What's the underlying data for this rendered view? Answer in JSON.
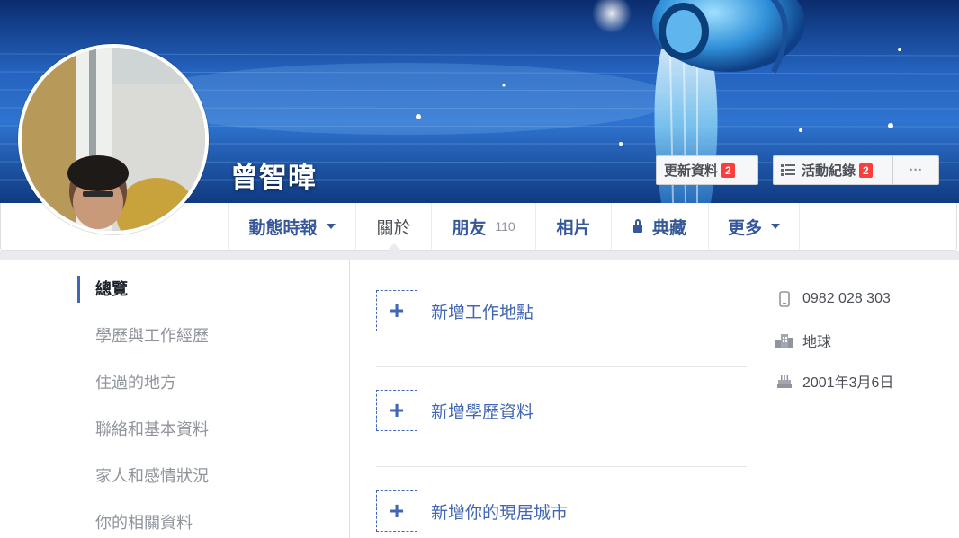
{
  "profile": {
    "name": "曾智暐"
  },
  "cover_actions": {
    "update_info_label": "更新資料",
    "update_info_badge": "2",
    "activity_log_label": "活動紀錄",
    "activity_log_badge": "2",
    "more_label": "···"
  },
  "tabs": [
    {
      "label": "動態時報",
      "dropdown": true
    },
    {
      "label": "關於",
      "active": true
    },
    {
      "label": "朋友",
      "count": "110"
    },
    {
      "label": "相片"
    },
    {
      "label": "典藏",
      "icon": "lock-icon"
    },
    {
      "label": "更多",
      "dropdown": true
    }
  ],
  "sidebar": {
    "items": [
      {
        "label": "總覽",
        "active": true
      },
      {
        "label": "學歷與工作經歷"
      },
      {
        "label": "住過的地方"
      },
      {
        "label": "聯絡和基本資料"
      },
      {
        "label": "家人和感情狀況"
      },
      {
        "label": "你的相關資料"
      }
    ]
  },
  "overview": {
    "add_items": [
      {
        "label": "新增工作地點",
        "icon": "plus-icon"
      },
      {
        "label": "新增學歷資料",
        "icon": "plus-icon"
      },
      {
        "label": "新增你的現居城市",
        "icon": "plus-icon"
      }
    ],
    "info": [
      {
        "icon": "phone-icon",
        "text": "0982 028 303"
      },
      {
        "icon": "city-icon",
        "text": "地球"
      },
      {
        "icon": "birthday-cake-icon",
        "text": "2001年3月6日"
      }
    ]
  },
  "colors": {
    "link_blue": "#4267b2",
    "tab_blue": "#365899",
    "badge_red": "#fa3e3e",
    "muted_gray": "#90949c"
  }
}
